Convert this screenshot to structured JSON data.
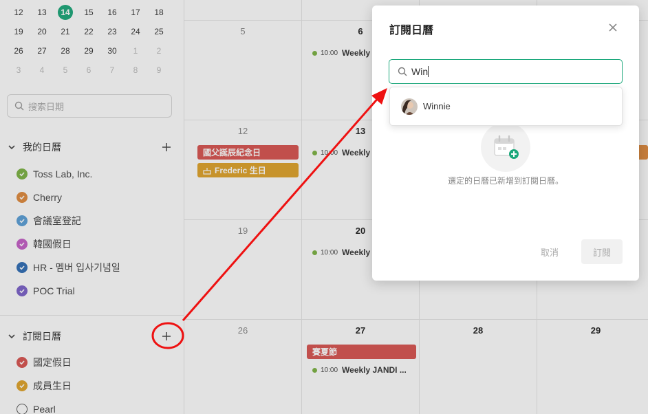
{
  "sidebar": {
    "mini_calendar": [
      [
        "12",
        "13",
        "14",
        "15",
        "16",
        "17",
        "18"
      ],
      [
        "19",
        "20",
        "21",
        "22",
        "23",
        "24",
        "25"
      ],
      [
        "26",
        "27",
        "28",
        "29",
        "30",
        "1",
        "2"
      ],
      [
        "3",
        "4",
        "5",
        "6",
        "7",
        "8",
        "9"
      ]
    ],
    "today": "14",
    "search_placeholder": "搜索日期",
    "my_calendars": {
      "title": "我的日曆",
      "items": [
        {
          "label": "Toss Lab, Inc.",
          "color": "#7cb342"
        },
        {
          "label": "Cherry",
          "color": "#e08a3c"
        },
        {
          "label": "會議室登記",
          "color": "#5a9fd8"
        },
        {
          "label": "韓國假日",
          "color": "#c55fc7"
        },
        {
          "label": "HR - 멤버 입사기념일",
          "color": "#2e6db5"
        },
        {
          "label": "POC Trial",
          "color": "#7b61c9"
        }
      ]
    },
    "subscribed": {
      "title": "訂閱日曆",
      "items": [
        {
          "label": "國定假日",
          "color": "#d9534f"
        },
        {
          "label": "成員生日",
          "color": "#e0a328"
        },
        {
          "label": "Pearl",
          "color": "#ffffff"
        }
      ]
    }
  },
  "calendar": {
    "row1": {
      "days": [
        "5",
        "6"
      ]
    },
    "row2": {
      "days": [
        "12",
        "13"
      ]
    },
    "row3": {
      "days": [
        "19",
        "20"
      ]
    },
    "row4": {
      "days": [
        "26",
        "27",
        "28",
        "29"
      ]
    },
    "events": {
      "weekly_time": "10:00",
      "weekly_short": "Weekly",
      "weekly_long": "Weekly JANDI ...",
      "holiday1": "國父誕辰紀念日",
      "birthday": "Frederic 生日",
      "holiday2": "賽夏節"
    }
  },
  "modal": {
    "title": "訂閱日曆",
    "search_value": "Win",
    "result_name": "Winnie",
    "empty_message": "選定的日曆已新增到訂閱日曆。",
    "cancel_label": "取消",
    "subscribe_label": "訂閱"
  },
  "colors": {
    "accent": "#1aa77a",
    "annotation": "#e11"
  }
}
